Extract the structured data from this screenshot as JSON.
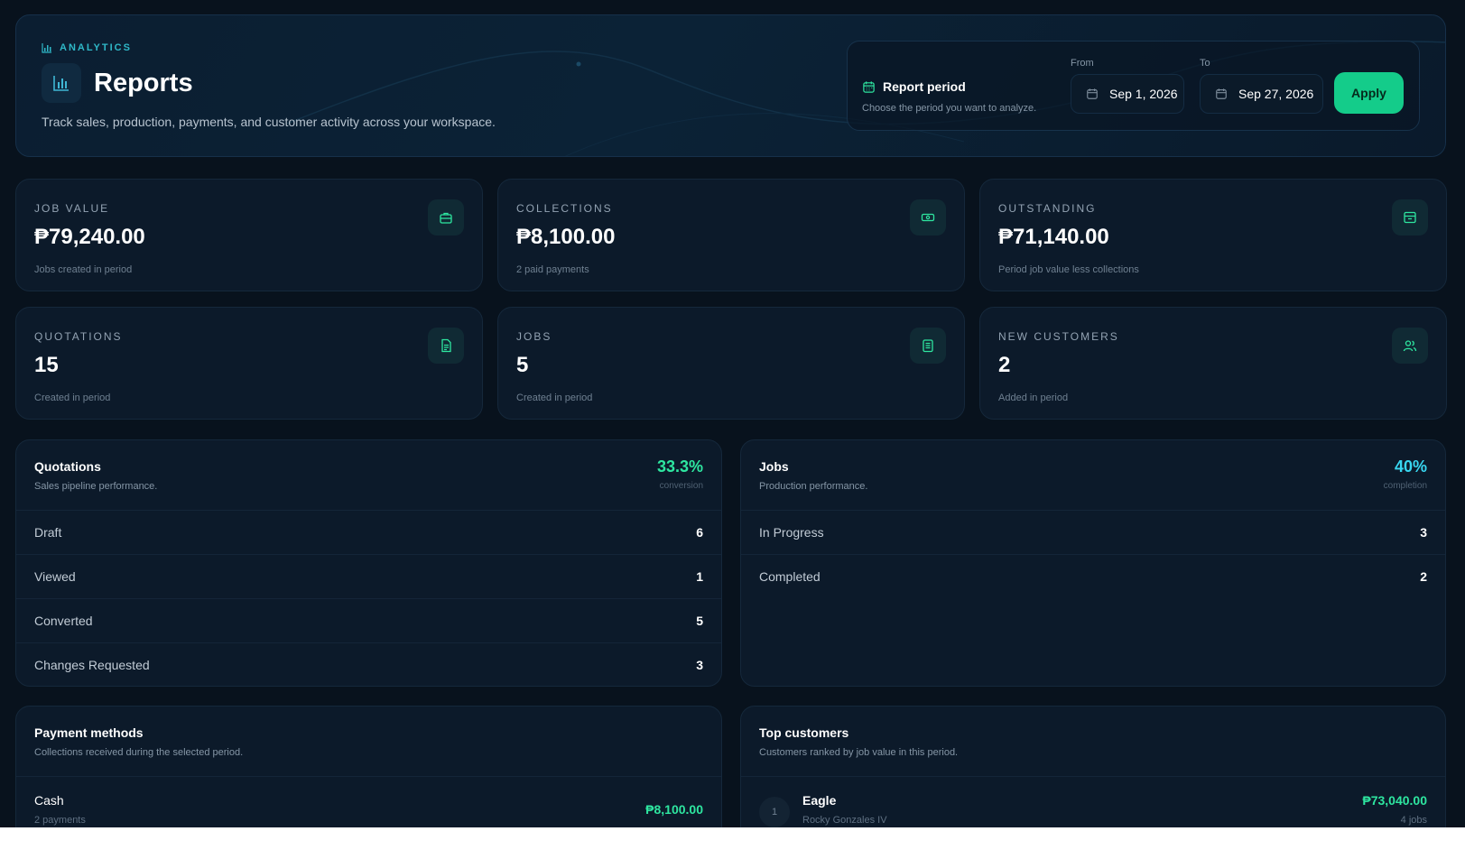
{
  "header": {
    "eyebrow": "ANALYTICS",
    "title": "Reports",
    "subtitle": "Track sales, production, payments, and customer activity across your workspace.",
    "period_label": "Report period",
    "period_hint": "Choose the period you want to analyze.",
    "from_label": "From",
    "from_value": "Sep 1, 2026",
    "to_label": "To",
    "to_value": "Sep 27, 2026",
    "apply_label": "Apply"
  },
  "stats": [
    {
      "label": "JOB VALUE",
      "value": "₱79,240.00",
      "note": "Jobs created in period",
      "icon": "briefcase-icon"
    },
    {
      "label": "COLLECTIONS",
      "value": "₱8,100.00",
      "note": "2 paid payments",
      "icon": "cash-icon"
    },
    {
      "label": "OUTSTANDING",
      "value": "₱71,140.00",
      "note": "Period job value less collections",
      "icon": "inbox-icon"
    },
    {
      "label": "QUOTATIONS",
      "value": "15",
      "note": "Created in period",
      "icon": "document-icon"
    },
    {
      "label": "JOBS",
      "value": "5",
      "note": "Created in period",
      "icon": "clipboard-icon"
    },
    {
      "label": "NEW CUSTOMERS",
      "value": "2",
      "note": "Added in period",
      "icon": "users-icon"
    }
  ],
  "quotations_panel": {
    "title": "Quotations",
    "subtitle": "Sales pipeline performance.",
    "metric": "33.3%",
    "metric_label": "conversion",
    "rows": [
      {
        "label": "Draft",
        "value": "6"
      },
      {
        "label": "Viewed",
        "value": "1"
      },
      {
        "label": "Converted",
        "value": "5"
      },
      {
        "label": "Changes Requested",
        "value": "3"
      }
    ]
  },
  "jobs_panel": {
    "title": "Jobs",
    "subtitle": "Production performance.",
    "metric": "40%",
    "metric_label": "completion",
    "rows": [
      {
        "label": "In Progress",
        "value": "3"
      },
      {
        "label": "Completed",
        "value": "2"
      }
    ]
  },
  "payments_panel": {
    "title": "Payment methods",
    "subtitle": "Collections received during the selected period.",
    "items": [
      {
        "name": "Cash",
        "sub": "2 payments",
        "amount": "₱8,100.00"
      }
    ]
  },
  "customers_panel": {
    "title": "Top customers",
    "subtitle": "Customers ranked by job value in this period.",
    "items": [
      {
        "rank": "1",
        "name": "Eagle",
        "contact": "Rocky Gonzales IV",
        "amount": "₱73,040.00",
        "jobs": "4 jobs"
      }
    ]
  },
  "colors": {
    "accent_green": "#14cc8a",
    "metric_green": "#2ee6a0",
    "metric_cyan": "#38d6f0",
    "eyebrow_teal": "#2fb8c8"
  }
}
